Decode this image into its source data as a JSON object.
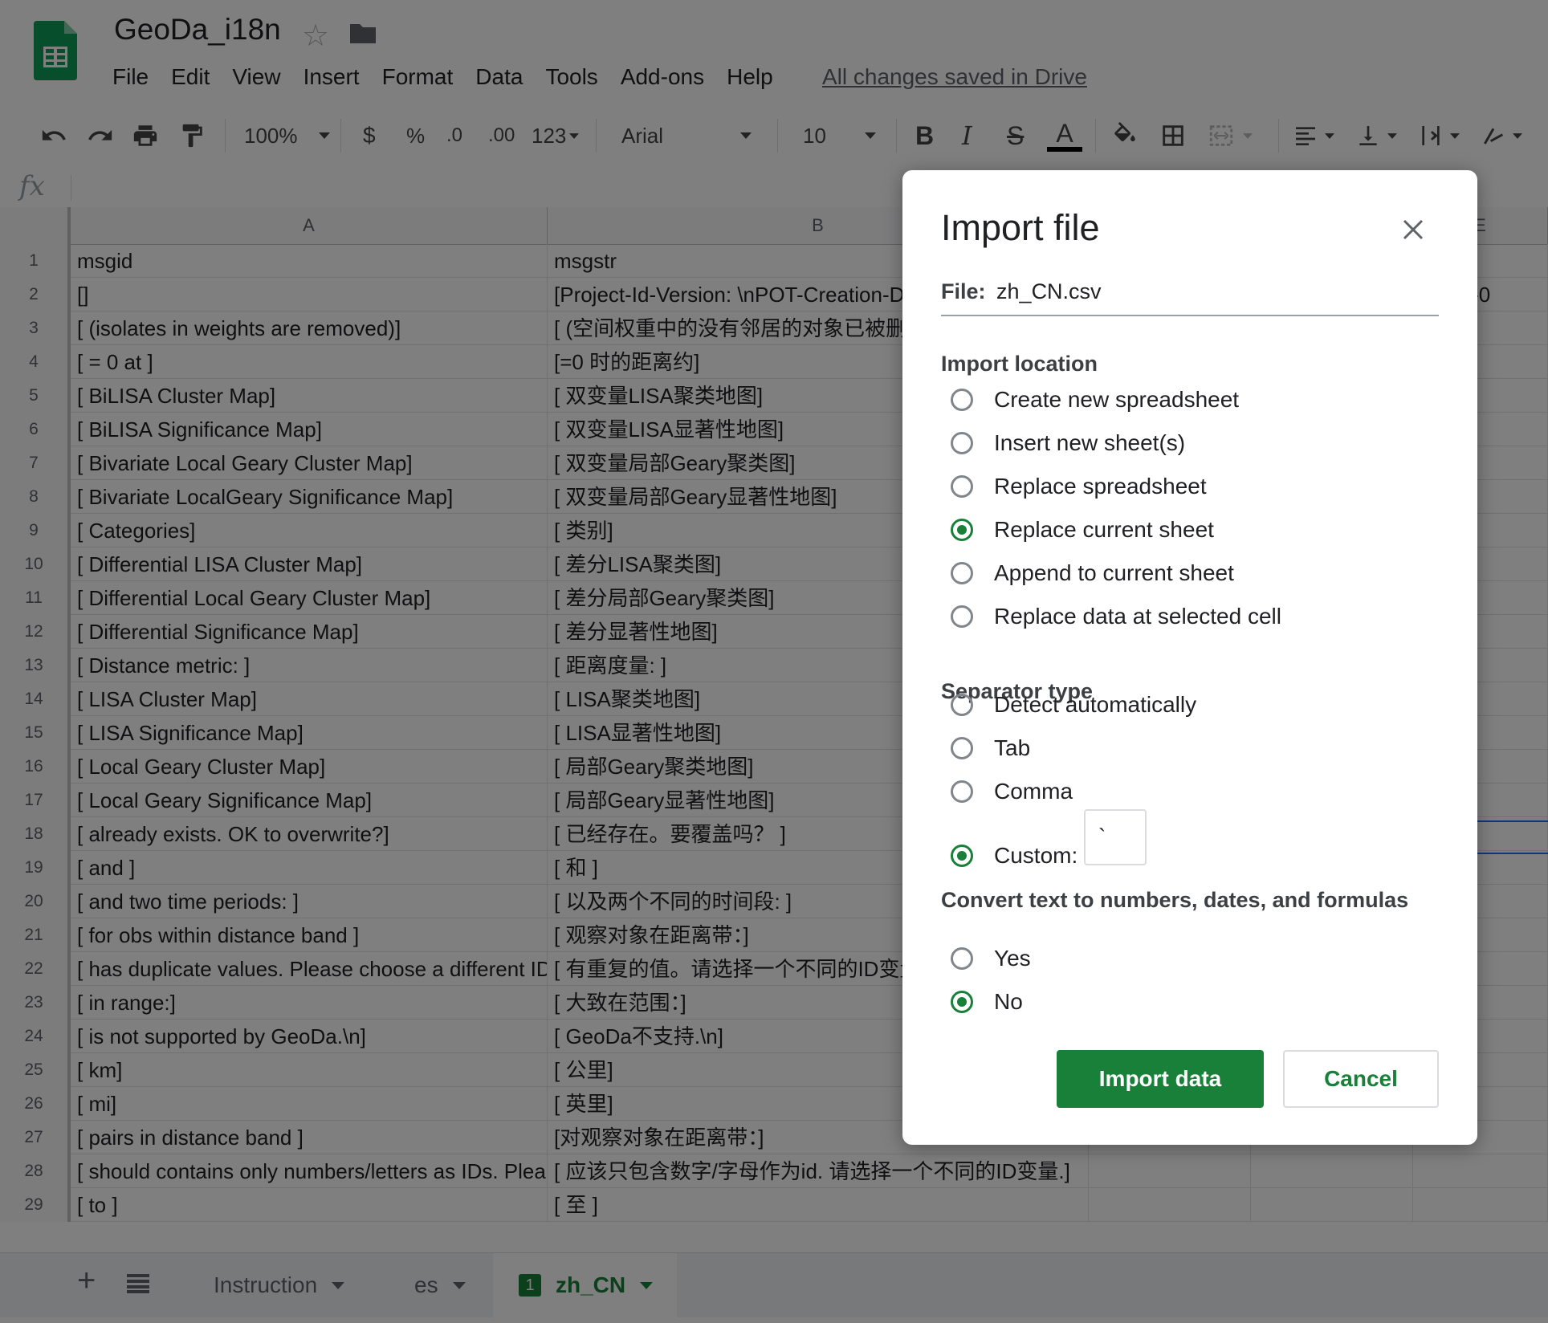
{
  "app": {
    "title": "GeoDa_i18n",
    "save_status": "All changes saved in Drive",
    "brand_color": "#188038"
  },
  "menu": [
    "File",
    "Edit",
    "View",
    "Insert",
    "Format",
    "Data",
    "Tools",
    "Add-ons",
    "Help"
  ],
  "toolbar": {
    "zoom": "100%",
    "currency": "$",
    "percent": "%",
    "decrease_decimal": ".0",
    "increase_decimal": ".00",
    "more_formats": "123",
    "font": "Arial",
    "font_size": "10",
    "bold": "B",
    "italic": "I",
    "strikethrough": "S",
    "text_color": "A"
  },
  "formula_bar": {
    "icon": "fx"
  },
  "columns": [
    "A",
    "B",
    "E"
  ],
  "rows": [
    {
      "n": "1",
      "a": "msgid",
      "b": "msgstr",
      "e": ""
    },
    {
      "n": "2",
      "a": "[]",
      "b": "[Project-Id-Version: \\nPOT-Creation-D",
      "e": "14:33-0"
    },
    {
      "n": "3",
      "a": "[ (isolates in weights are removed)]",
      "b": "[ (空间权重中的没有邻居的对象已被删",
      "e": ""
    },
    {
      "n": "4",
      "a": "[ = 0 at ]",
      "b": "[=0 时的距离约]",
      "e": ""
    },
    {
      "n": "5",
      "a": "[ BiLISA Cluster Map]",
      "b": "[ 双变量LISA聚类地图]",
      "e": ""
    },
    {
      "n": "6",
      "a": "[ BiLISA Significance Map]",
      "b": "[ 双变量LISA显著性地图]",
      "e": ""
    },
    {
      "n": "7",
      "a": "[ Bivariate Local Geary Cluster Map]",
      "b": "[ 双变量局部Geary聚类图]",
      "e": ""
    },
    {
      "n": "8",
      "a": "[ Bivariate LocalGeary Significance Map]",
      "b": "[ 双变量局部Geary显著性地图]",
      "e": ""
    },
    {
      "n": "9",
      "a": "[ Categories]",
      "b": "[ 类别]",
      "e": ""
    },
    {
      "n": "10",
      "a": "[ Differential LISA Cluster Map]",
      "b": "[ 差分LISA聚类图]",
      "e": ""
    },
    {
      "n": "11",
      "a": "[ Differential Local Geary Cluster Map]",
      "b": "[ 差分局部Geary聚类图]",
      "e": ""
    },
    {
      "n": "12",
      "a": "[ Differential Significance Map]",
      "b": "[ 差分显著性地图]",
      "e": ""
    },
    {
      "n": "13",
      "a": "[ Distance metric: ]",
      "b": "[ 距离度量: ]",
      "e": ""
    },
    {
      "n": "14",
      "a": "[ LISA Cluster Map]",
      "b": "[ LISA聚类地图]",
      "e": ""
    },
    {
      "n": "15",
      "a": "[ LISA Significance Map]",
      "b": "[ LISA显著性地图]",
      "e": ""
    },
    {
      "n": "16",
      "a": "[ Local Geary Cluster Map]",
      "b": "[ 局部Geary聚类地图]",
      "e": ""
    },
    {
      "n": "17",
      "a": "[ Local Geary Significance Map]",
      "b": "[ 局部Geary显著性地图]",
      "e": ""
    },
    {
      "n": "18",
      "a": "[ already exists.  OK to overwrite?]",
      "b": "[ 已经存在。要覆盖吗？ ]",
      "e": ""
    },
    {
      "n": "19",
      "a": "[ and ]",
      "b": "[ 和 ]",
      "e": ""
    },
    {
      "n": "20",
      "a": "[ and two time periods: ]",
      "b": "[ 以及两个不同的时间段: ]",
      "e": ""
    },
    {
      "n": "21",
      "a": "[ for obs within distance band ]",
      "b": "[ 观察对象在距离带：]",
      "e": ""
    },
    {
      "n": "22",
      "a": "[ has duplicate values. Please choose a different ID",
      "b": "[ 有重复的值。请选择一个不同的ID变量",
      "e": ""
    },
    {
      "n": "23",
      "a": "[ in range:]",
      "b": "[ 大致在范围：]",
      "e": ""
    },
    {
      "n": "24",
      "a": "[ is not supported by GeoDa.\\n]",
      "b": "[ GeoDa不支持.\\n]",
      "e": ""
    },
    {
      "n": "25",
      "a": "[ km]",
      "b": "[ 公里]",
      "e": ""
    },
    {
      "n": "26",
      "a": "[ mi]",
      "b": "[ 英里]",
      "e": ""
    },
    {
      "n": "27",
      "a": "[ pairs in distance band ]",
      "b": "[对观察对象在距离带：]",
      "e": ""
    },
    {
      "n": "28",
      "a": "[ should contains only numbers/letters as IDs.  Plea",
      "b": "[ 应该只包含数字/字母作为id. 请选择一个不同的ID变量.]",
      "e": ""
    },
    {
      "n": "29",
      "a": "[ to ]",
      "b": "[ 至 ]",
      "e": ""
    }
  ],
  "sheet_tabs": {
    "tabs": [
      "Instruction",
      "es",
      "zh_CN"
    ],
    "active": "zh_CN",
    "active_badge": "1"
  },
  "dialog": {
    "title": "Import file",
    "file_label": "File:",
    "file_name": "zh_CN.csv",
    "import_location": {
      "label": "Import location",
      "options": [
        "Create new spreadsheet",
        "Insert new sheet(s)",
        "Replace spreadsheet",
        "Replace current sheet",
        "Append to current sheet",
        "Replace data at selected cell"
      ],
      "selected": "Replace current sheet"
    },
    "separator": {
      "label": "Separator type",
      "options": [
        "Detect automatically",
        "Tab",
        "Comma",
        "Custom:"
      ],
      "selected": "Custom:",
      "custom_value": "`"
    },
    "convert": {
      "label": "Convert text to numbers, dates, and formulas",
      "options": [
        "Yes",
        "No"
      ],
      "selected": "No"
    },
    "import_button": "Import data",
    "cancel_button": "Cancel"
  }
}
